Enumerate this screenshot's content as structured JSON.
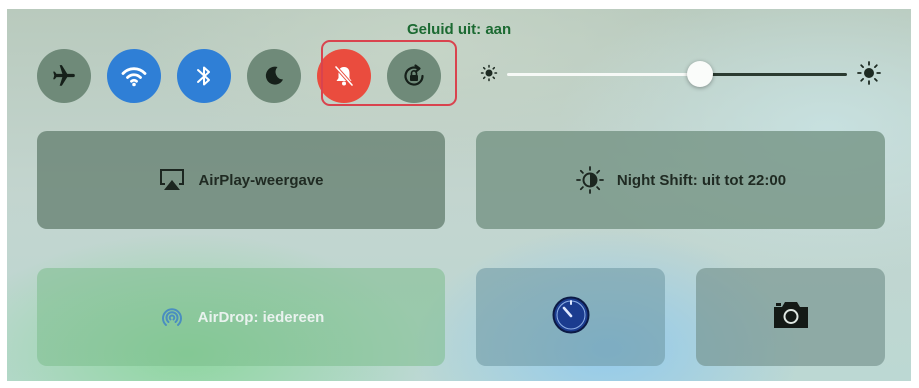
{
  "tooltip": "Geluid uit: aan",
  "toggles": [
    {
      "name": "airplane-mode-toggle",
      "icon": "airplane-icon",
      "active": false
    },
    {
      "name": "wifi-toggle",
      "icon": "wifi-icon",
      "active": true
    },
    {
      "name": "bluetooth-toggle",
      "icon": "bluetooth-icon",
      "active": true
    },
    {
      "name": "do-not-disturb-toggle",
      "icon": "moon-icon",
      "active": false
    },
    {
      "name": "mute-toggle",
      "icon": "bell-slash-icon",
      "active": true
    },
    {
      "name": "rotation-lock-toggle",
      "icon": "rotation-lock-icon",
      "active": false
    }
  ],
  "brightness": {
    "level": 0.55
  },
  "tiles": {
    "airplay": {
      "label": "AirPlay-weergave",
      "icon": "airplay-icon"
    },
    "night_shift": {
      "label": "Night Shift: uit tot 22:00",
      "icon": "sun-icon"
    },
    "airdrop": {
      "label": "AirDrop: iedereen",
      "icon": "airdrop-icon"
    },
    "timer": {
      "icon": "timer-icon"
    },
    "camera": {
      "icon": "camera-icon"
    }
  },
  "colors": {
    "active_blue": "#2f7fd6",
    "mute_red": "#ea4c3e",
    "highlight_border": "#d9434e",
    "tooltip_green": "#1c6a32"
  }
}
